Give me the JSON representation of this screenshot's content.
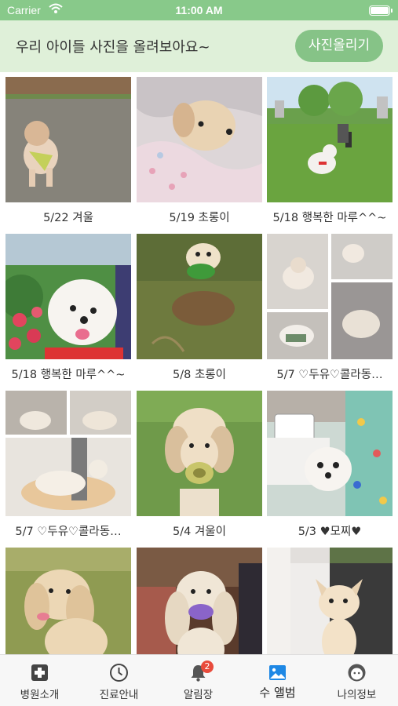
{
  "status_bar": {
    "carrier": "Carrier",
    "time": "11:00 AM"
  },
  "header": {
    "title": "우리 아이들 사진을 올려보아요~",
    "upload_button": "사진올리기",
    "background_color": "#dff0d9",
    "accent_color": "#86c387"
  },
  "album": {
    "items": [
      {
        "caption": "5/22  겨울",
        "photo": "dog running on field"
      },
      {
        "caption": "5/19  초롱이",
        "photo": "dog resting on blanket"
      },
      {
        "caption": "5/18  행복한 마루^^~",
        "photo": "dog on lawn in park"
      },
      {
        "caption": "5/18  행복한 마루^^~",
        "photo": "dog with flowers"
      },
      {
        "caption": "5/8  초롱이",
        "photo": "dog on grass and dirt"
      },
      {
        "caption": "5/7  ♡두유♡콜라동…",
        "photo": "cat collage"
      },
      {
        "caption": "5/7  ♡두유♡콜라동…",
        "photo": "dog collage on floor"
      },
      {
        "caption": "5/4  겨울이",
        "photo": "dog with chew toy"
      },
      {
        "caption": "5/3  ♥모찌♥",
        "photo": "dog held in lap"
      },
      {
        "caption": "",
        "photo": "spaniel on grass"
      },
      {
        "caption": "",
        "photo": "spaniel with toy on sofa"
      },
      {
        "caption": "",
        "photo": "chihuahua by door"
      }
    ]
  },
  "tab_bar": {
    "tabs": [
      {
        "label": "병원소개",
        "icon": "hospital-cross-icon"
      },
      {
        "label": "진료안내",
        "icon": "clock-icon"
      },
      {
        "label": "알림장",
        "icon": "bell-icon",
        "badge": "2"
      },
      {
        "label": "수 앨범",
        "icon": "photo-album-icon",
        "active": true
      },
      {
        "label": "나의정보",
        "icon": "profile-face-icon"
      }
    ]
  }
}
